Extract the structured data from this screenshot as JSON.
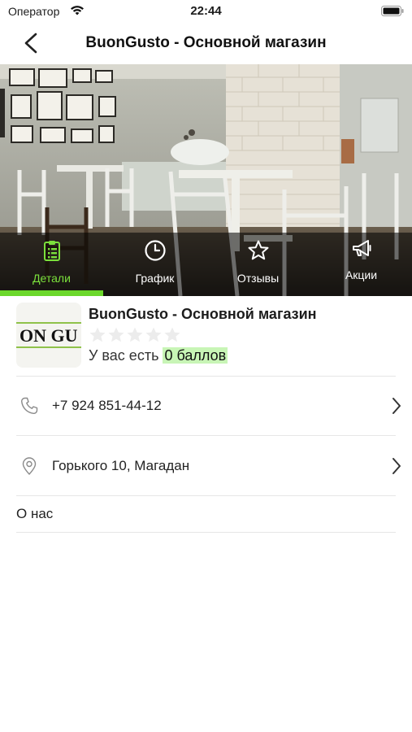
{
  "status_bar": {
    "carrier": "Оператор",
    "time": "22:44"
  },
  "nav": {
    "title": "BuonGusto - Основной магазин",
    "back_icon": "chevron-left-icon"
  },
  "tabs": [
    {
      "label": "Детали",
      "icon": "clipboard-list-icon",
      "active": true
    },
    {
      "label": "График",
      "icon": "clock-icon",
      "active": false
    },
    {
      "label": "Отзывы",
      "icon": "star-icon",
      "active": false
    },
    {
      "label": "Акции",
      "icon": "megaphone-icon",
      "active": false
    }
  ],
  "store": {
    "name": "BuonGusto - Основной магазин",
    "logo_text": "ON GU",
    "rating": 0,
    "rating_max": 5,
    "points_prefix": "У вас есть",
    "points_value": "0 баллов"
  },
  "contacts": {
    "phone": "+7 924 851-44-12",
    "address": "Горького 10, Магадан"
  },
  "about_label": "О нас",
  "colors": {
    "accent": "#6bd82b",
    "points_highlight": "#c8f5b6"
  }
}
